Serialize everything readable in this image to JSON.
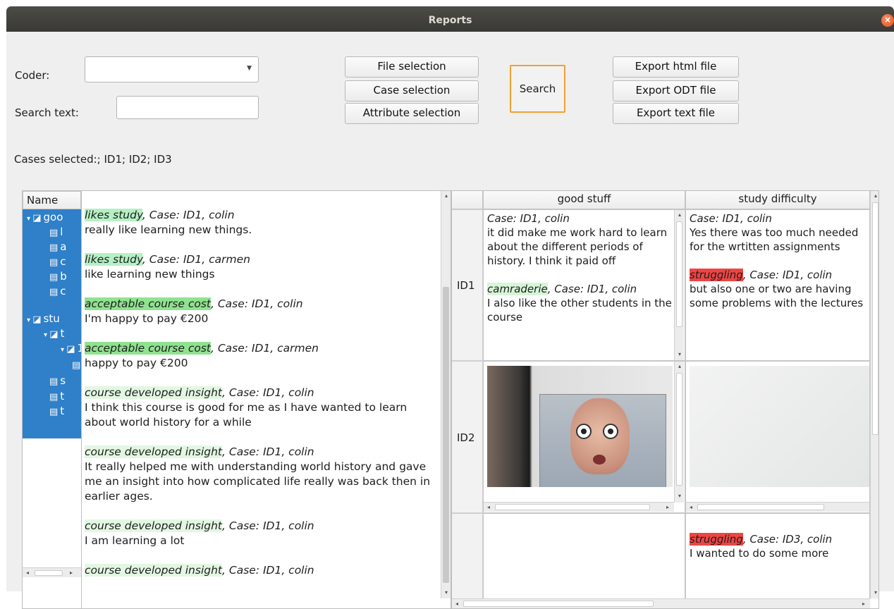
{
  "window": {
    "title": "Reports"
  },
  "controls": {
    "coder_label": "Coder:",
    "coder_value": "",
    "search_text_label": "Search text:",
    "search_text_value": "",
    "file_selection": "File selection",
    "case_selection": "Case selection",
    "attribute_selection": "Attribute selection",
    "search": "Search",
    "export_html": "Export html file",
    "export_odt": "Export ODT file",
    "export_text": "Export text file"
  },
  "cases_selected": "Cases selected:; ID1; ID2; ID3",
  "tree": {
    "header": "Name",
    "items": [
      {
        "text": "goo",
        "kind": "category"
      },
      {
        "text": "l",
        "kind": "code"
      },
      {
        "text": "a",
        "kind": "code"
      },
      {
        "text": "c",
        "kind": "code"
      },
      {
        "text": "b",
        "kind": "code"
      },
      {
        "text": "c",
        "kind": "code"
      },
      {
        "text": "stu",
        "kind": "category"
      },
      {
        "text": "t",
        "kind": "category"
      },
      {
        "text": "1",
        "kind": "category"
      },
      {
        "text": "",
        "kind": "code"
      },
      {
        "text": "s",
        "kind": "code"
      },
      {
        "text": "t",
        "kind": "code"
      },
      {
        "text": "t",
        "kind": "code"
      }
    ]
  },
  "results": [
    {
      "code": "likes study",
      "meta": ", Case: ID1, colin",
      "text": " really like learning new things.",
      "color": "#b5f0c4"
    },
    {
      "code": "likes study",
      "meta": ", Case: ID1, carmen",
      "text": "like learning new things",
      "color": "#b5f0c4"
    },
    {
      "code": "acceptable course cost",
      "meta": ", Case: ID1, colin",
      "text": "I'm happy to pay €200",
      "color": "#8fe28f"
    },
    {
      "code": "acceptable course cost",
      "meta": ", Case: ID1, carmen",
      "text": "happy to pay €200",
      "color": "#8fe28f"
    },
    {
      "code": "course developed insight",
      "meta": ", Case: ID1, colin",
      "text": "I think this course is good for me as I have wanted to learn about world history for a while",
      "color": "#e2f7e2"
    },
    {
      "code": "course developed insight",
      "meta": ", Case: ID1, colin",
      "text": "It really helped me with understanding world history and gave me an insight into how complicated life really was back then in earlier ages.",
      "color": "#e2f7e2"
    },
    {
      "code": "course developed insight",
      "meta": ", Case: ID1, colin",
      "text": "I am learning a lot",
      "color": "#e2f7e2"
    },
    {
      "code": "course developed insight",
      "meta": ", Case: ID1, colin",
      "text": "",
      "color": "#e2f7e2"
    }
  ],
  "matrix": {
    "columns": [
      "good stuff",
      "study difficulty"
    ],
    "rows": [
      "ID1",
      "ID2",
      ""
    ],
    "id1_good": {
      "meta1": "Case: ID1, colin",
      "text1": "it did make me work hard to learn about the different periods of history. I think it paid off",
      "code2": "camraderie",
      "meta2": ", Case: ID1, colin",
      "text2": "I also like the other students in the course"
    },
    "id1_diff": {
      "meta1": "Case: ID1, colin",
      "text1": "Yes there was too much needed for the wrtitten assignments",
      "code2": "struggling",
      "meta2": ", Case: ID1, colin",
      "text2": "but also one or two are having some problems with the lectures"
    },
    "id3_diff": {
      "code": "struggling",
      "meta": ", Case: ID3, colin",
      "text": "I wanted to do some more"
    },
    "colors": {
      "camraderie": "#d7f5d7",
      "struggling": "#ef4444"
    }
  }
}
